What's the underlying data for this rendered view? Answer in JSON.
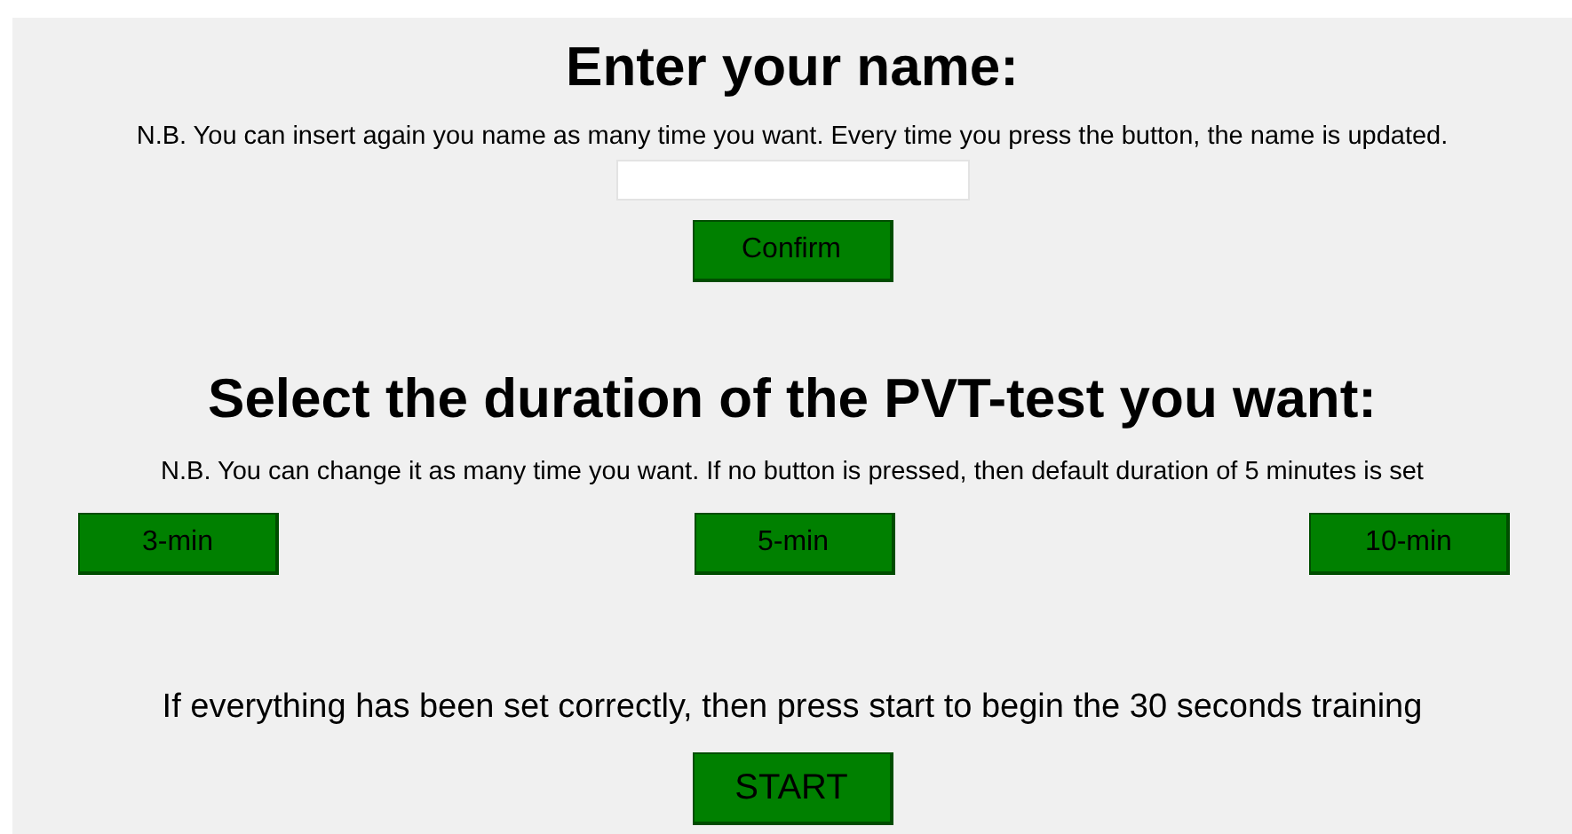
{
  "name_section": {
    "title": "Enter your name:",
    "note": "N.B. You can insert again you name as many time you want. Every time you press the button, the name is updated.",
    "confirm_button": "Confirm"
  },
  "duration_section": {
    "title": "Select the duration of the PVT-test you want:",
    "note": "N.B. You can change it as many time you want. If no button is pressed, then default duration of 5 minutes is set",
    "buttons": [
      "3-min",
      "5-min",
      "10-min"
    ]
  },
  "start_section": {
    "instruction": "If everything has been set correctly, then press start to begin the 30 seconds training",
    "start_button": "START"
  }
}
